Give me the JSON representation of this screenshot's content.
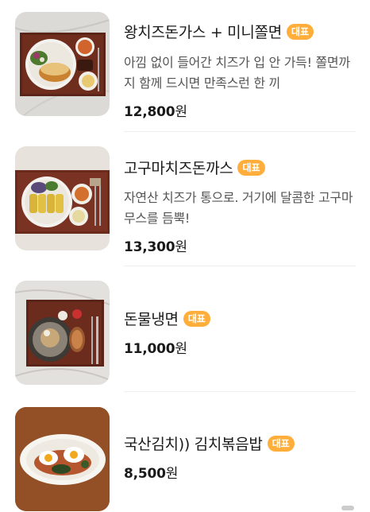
{
  "menu": {
    "items": [
      {
        "name": "왕치즈돈가스 + 미니쫄면",
        "badge": "대표",
        "description": "아낌 없이 들어간 치즈가 입 안 가득! 쫄면까지 함께 드시면 만족스런 한 끼",
        "price": "12,800",
        "price_unit": "원"
      },
      {
        "name": "고구마치즈돈까스",
        "badge": "대표",
        "description": "자연산 치즈가 통으로. 거기에 달콤한 고구마 무스를 듬뿍!",
        "price": "13,300",
        "price_unit": "원"
      },
      {
        "name": "돈물냉면",
        "badge": "대표",
        "price": "11,000",
        "price_unit": "원"
      },
      {
        "name": "국산김치)) 김치볶음밥",
        "badge": "대표",
        "price": "8,500",
        "price_unit": "원"
      }
    ]
  }
}
